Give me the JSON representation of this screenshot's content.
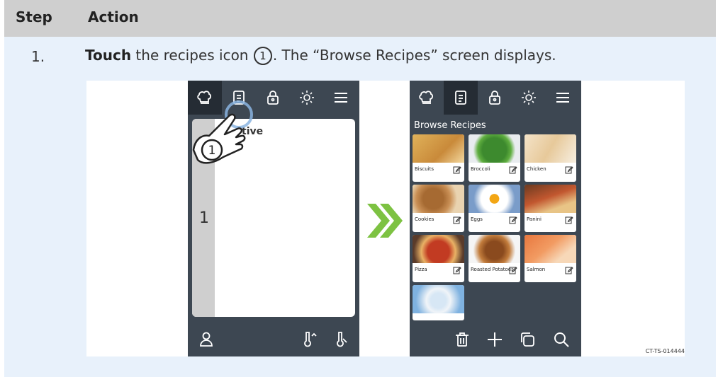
{
  "table": {
    "header": {
      "step": "Step",
      "action": "Action"
    },
    "row": {
      "number": "1.",
      "instruction": {
        "verb": "Touch",
        "pre": "the recipes icon",
        "marker": "1",
        "post": ". The “Browse Recipes” screen displays."
      }
    }
  },
  "figure": {
    "left_screen": {
      "tabs": [
        "chef-hat-icon",
        "recipe-card-icon",
        "lock-icon",
        "brightness-icon",
        "menu-icon"
      ],
      "panel_label": "tive",
      "strip_number": "1",
      "callout_number": "1",
      "bottom_icons": [
        "user-icon",
        "probe-up-icon",
        "probe-icon"
      ]
    },
    "right_screen": {
      "title": "Browse Recipes",
      "recipes": [
        {
          "name": "Biscuits"
        },
        {
          "name": "Broccoli"
        },
        {
          "name": "Chicken"
        },
        {
          "name": "Cookies"
        },
        {
          "name": "Eggs"
        },
        {
          "name": "Panini"
        },
        {
          "name": "Pizza"
        },
        {
          "name": "Roasted Potatoes"
        },
        {
          "name": "Salmon"
        },
        {
          "name": ""
        }
      ],
      "bottom_icons": [
        "trash-icon",
        "plus-icon",
        "copy-icon",
        "search-icon"
      ]
    },
    "code": "CT-TS-014444"
  },
  "colors": {
    "header_bg": "#cfcfcf",
    "row_bg": "#e8f1fb",
    "device_bg": "#3d4752",
    "tab_selected": "#252c34",
    "arrow_green": "#7dc242"
  }
}
